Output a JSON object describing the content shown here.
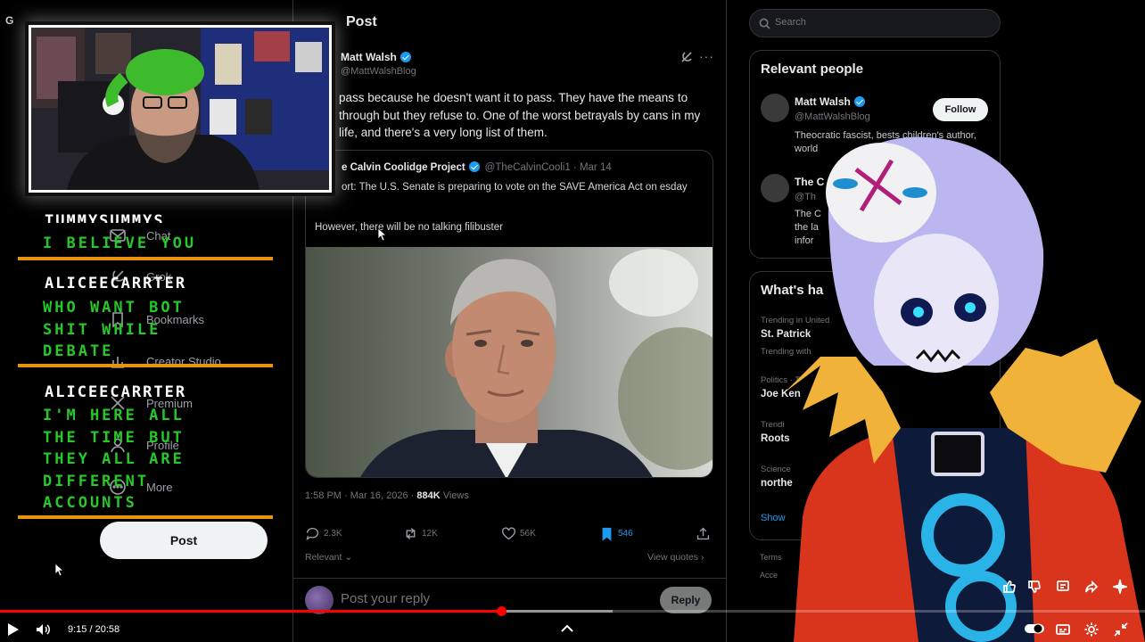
{
  "nav": {
    "letter": "G",
    "items": [
      {
        "label": "Chat",
        "icon": "mail-icon"
      },
      {
        "label": "Grok",
        "icon": "grok-icon"
      },
      {
        "label": "Bookmarks",
        "icon": "bookmark-icon"
      },
      {
        "label": "Creator Studio",
        "icon": "chart-icon"
      },
      {
        "label": "Premium",
        "icon": "x-logo-icon"
      },
      {
        "label": "Profile",
        "icon": "person-icon"
      },
      {
        "label": "More",
        "icon": "more-circle-icon"
      }
    ],
    "post_button": "Post"
  },
  "post": {
    "header": "Post",
    "author_name": "Matt Walsh",
    "author_handle": "@MattWalshBlog",
    "text": "pass because he doesn't want it to pass. They have the means to through but they refuse to. One of the worst betrayals by cans in my life, and there's a very long list of them.",
    "quote": {
      "name": "e Calvin Coolidge Project",
      "handle": "@TheCalvinCooli1 · Mar 14",
      "text": "ort: The U.S. Senate is preparing to vote on the SAVE America Act on esday",
      "line": "However, there will be no talking filibuster"
    },
    "time": "1:58 PM · Mar 16, 2026 · ",
    "views_count": "884K",
    "views_label": " Views",
    "replies": "2.3K",
    "reposts": "12K",
    "likes": "56K",
    "bookmarks": "546",
    "relevant_label": "Relevant",
    "view_quotes": "View quotes",
    "reply_placeholder": "Post your reply",
    "reply_button": "Reply"
  },
  "sidebar": {
    "search_placeholder": "Search",
    "relevant_title": "Relevant people",
    "people": [
      {
        "name": "Matt Walsh",
        "handle": "@MattWalshBlog",
        "bio": "Theocratic fascist, bests     children's author, world",
        "follow": "Follow"
      },
      {
        "name": "The C",
        "handle": "@Th",
        "bio": "The C the la infor"
      }
    ],
    "happening_title": "What's ha",
    "trends": [
      {
        "category": "Trending in United",
        "name": "St. Patrick",
        "sub": "Trending with"
      },
      {
        "category": "Politics · T",
        "name": "Joe Ken"
      },
      {
        "category": "Trendi",
        "name": "Roots"
      },
      {
        "category": "Science",
        "name": "northe"
      }
    ],
    "show_more": "Show",
    "terms": "Terms",
    "access": "Acce"
  },
  "chat": {
    "partial_user": "TUMMYSUMMYS",
    "messages": [
      {
        "user": "",
        "text": "I BELIEVE YOU"
      },
      {
        "user": "ALICEECARRTER",
        "text": "WHO WANT BOT\nSHIT WHILE\nDEBATE"
      },
      {
        "user": "ALICEECARRTER",
        "text": "I'M HERE ALL\nTHE TIME BUT\nTHEY ALL ARE\nDIFFERENT\nACCOUNTS"
      }
    ]
  },
  "player": {
    "time": "9:15 / 20:58",
    "progress": 0.438,
    "buffered": 0.535
  },
  "colors": {
    "accent_blue": "#1d9bf0",
    "chat_green": "#26c928",
    "chat_bar": "#e8930e",
    "progress_red": "#ff0000"
  }
}
